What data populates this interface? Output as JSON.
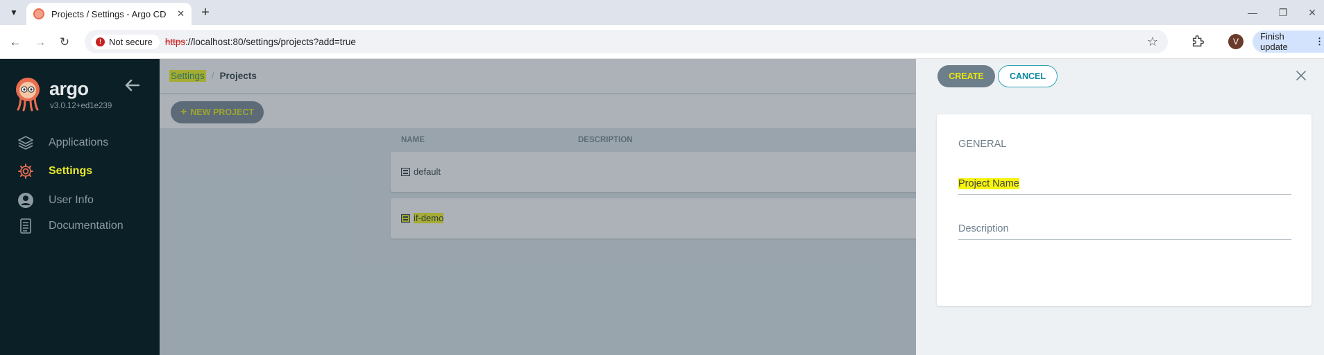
{
  "browser": {
    "tab_title": "Projects / Settings - Argo CD",
    "security_label": "Not secure",
    "url_scheme": "https",
    "url_rest": "://localhost:80/settings/projects?add=true",
    "profile_initial": "V",
    "update_label": "Finish update"
  },
  "sidebar": {
    "brand": "argo",
    "version": "v3.0.12+ed1e239",
    "items": [
      {
        "label": "Applications",
        "icon": "layers-icon"
      },
      {
        "label": "Settings",
        "icon": "gear-icon"
      },
      {
        "label": "User Info",
        "icon": "user-icon"
      },
      {
        "label": "Documentation",
        "icon": "book-icon"
      }
    ],
    "active_index": 1
  },
  "breadcrumb": {
    "parent": "Settings",
    "current": "Projects"
  },
  "actions": {
    "new_project_label": "NEW PROJECT"
  },
  "table": {
    "columns": [
      "NAME",
      "DESCRIPTION"
    ],
    "rows": [
      {
        "name": "default",
        "description": ""
      },
      {
        "name": "if-demo",
        "description": ""
      }
    ]
  },
  "panel": {
    "create_label": "CREATE",
    "cancel_label": "CANCEL",
    "section_title": "GENERAL",
    "fields": [
      {
        "label": "Project Name",
        "value": ""
      },
      {
        "label": "Description",
        "value": ""
      }
    ]
  },
  "colors": {
    "sidebar_bg": "#0b1f27",
    "active_nav": "#e9ea2a",
    "teal_accent": "#0d8aa0",
    "highlight": "#f5f50e"
  }
}
